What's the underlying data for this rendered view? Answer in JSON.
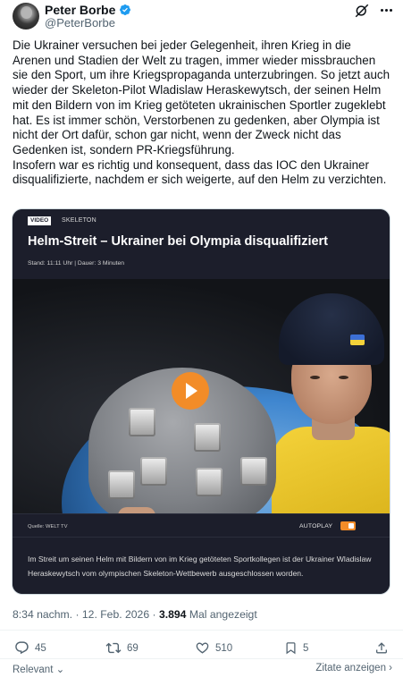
{
  "author": {
    "display_name": "Peter Borbe",
    "handle": "@PeterBorbe",
    "verified_color": "#1d9bf0"
  },
  "tweet": {
    "paragraphs": [
      "Die Ukrainer versuchen bei jeder Gelegenheit, ihren Krieg in die Arenen und Stadien der Welt zu tragen, immer wieder missbrauchen sie den Sport, um ihre Kriegspropaganda unterzubringen. So jetzt auch wieder der Skeleton-Pilot Wladislaw Heraskewytsch, der seinen Helm mit den Bildern von im Krieg getöteten ukrainischen Sportler zugeklebt hat. Es ist immer schön, Verstorbenen zu gedenken, aber Olympia ist nicht der Ort dafür, schon gar nicht, wenn der Zweck nicht das Gedenken ist, sondern PR-Kriegsführung.",
      "Insofern war es richtig und konsequent, dass das IOC den Ukrainer disqualifizierte, nachdem er sich weigerte, auf den Helm zu verzichten."
    ]
  },
  "card": {
    "badge": "VIDEO",
    "kicker": "SKELETON",
    "headline": "Helm-Streit – Ukrainer bei Olympia disqualifiziert",
    "meta": "Stand: 11:11 Uhr  |  Dauer: 3 Minuten",
    "source": "Quelle: WELT TV",
    "autoplay_label": "AUTOPLAY",
    "autoplay_on": true,
    "accent_color": "#f28c28",
    "caption": "Im Streit um seinen Helm mit Bildern von im Krieg getöteten Sportkollegen ist der Ukrainer Wladislaw Heraskewytsch vom olympischen Skeleton-Wettbewerb ausgeschlossen worden."
  },
  "timestamp": {
    "time_date": "8:34 nachm. · 12. Feb. 2026 · ",
    "views": "3.894",
    "views_label": " Mal angezeigt"
  },
  "actions": {
    "replies": "45",
    "reposts": "69",
    "likes": "510",
    "bookmarks": "5"
  },
  "footer": {
    "sort_label": "Relevant",
    "quotes_label": "Zitate anzeigen"
  }
}
